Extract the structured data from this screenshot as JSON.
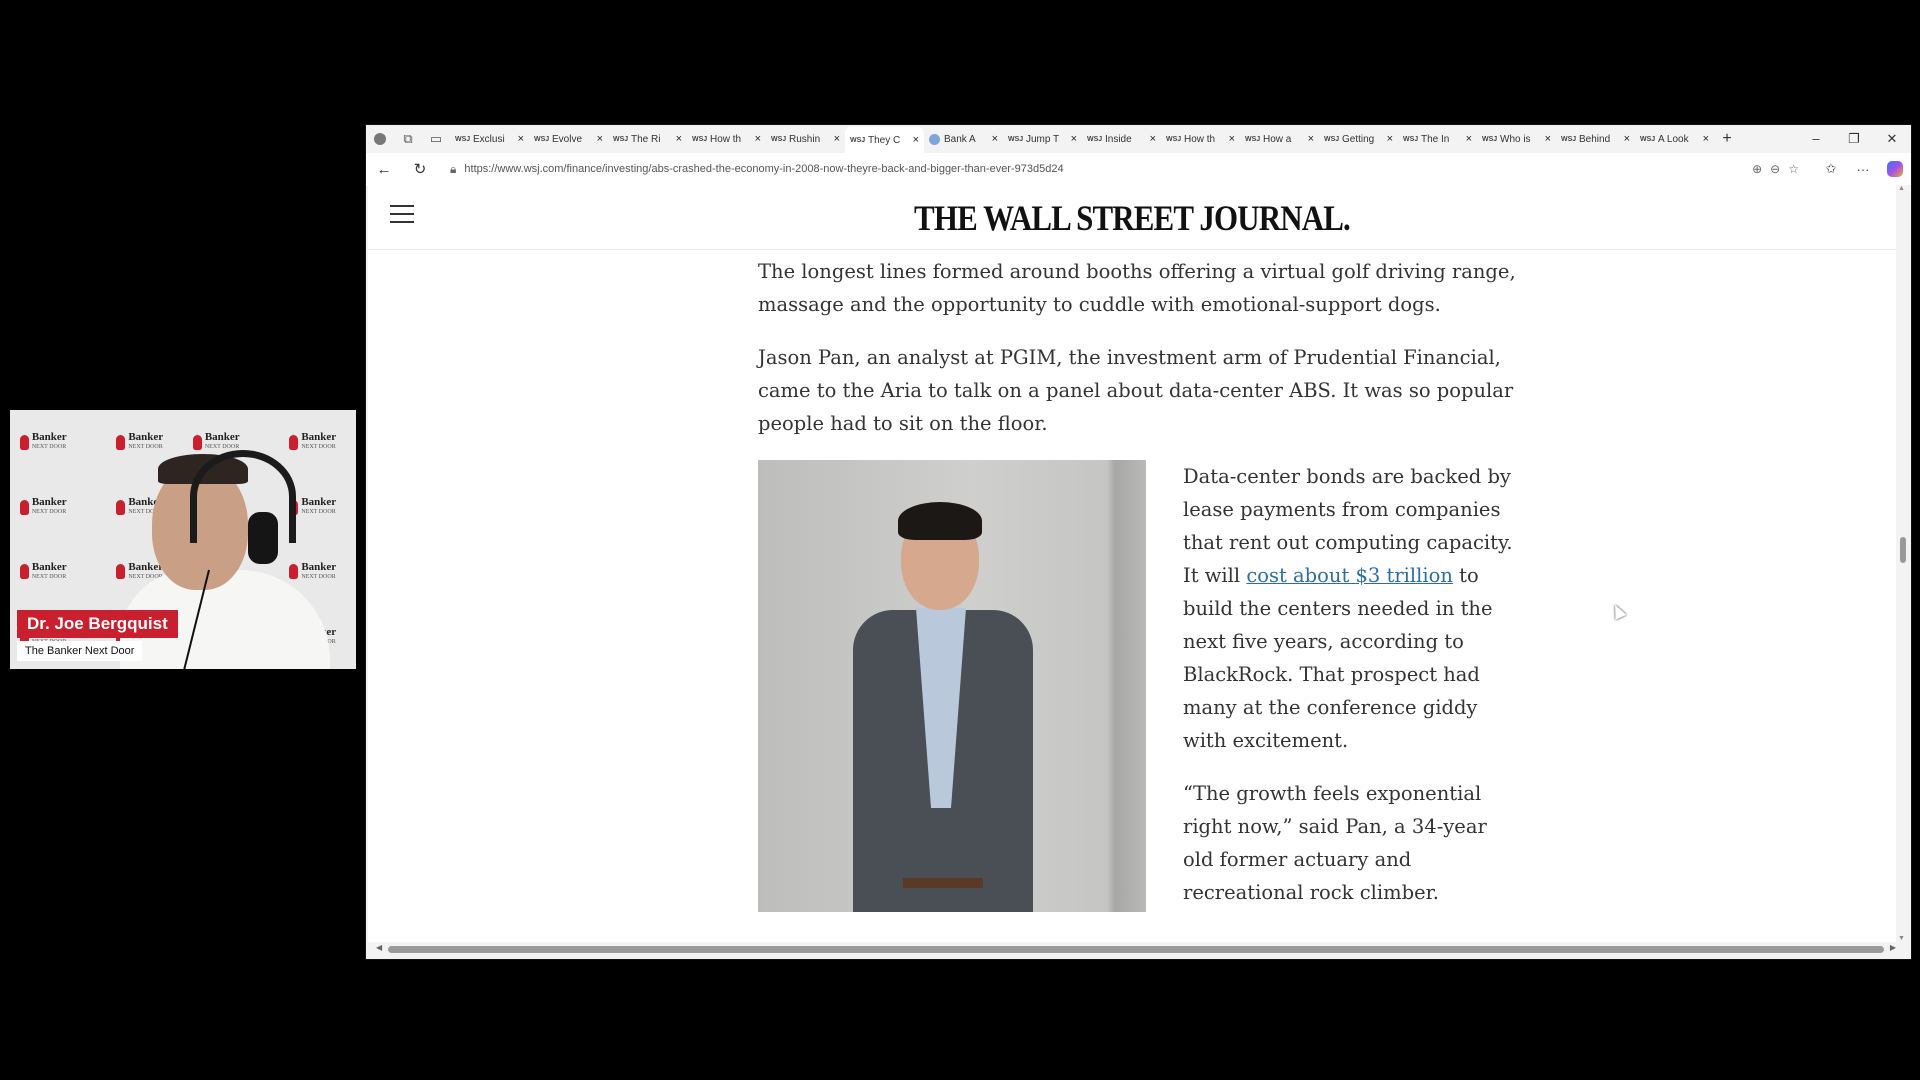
{
  "presenter": {
    "name": "Dr. Joe Bergquist",
    "show": "The Banker Next Door",
    "backdrop_logo": "Banker",
    "backdrop_logo_sub": "NEXT DOOR"
  },
  "browser": {
    "tabs": [
      {
        "label": "Exclusi",
        "favicon": "WSJ"
      },
      {
        "label": "Evolve",
        "favicon": "WSJ"
      },
      {
        "label": "The Ri",
        "favicon": "WSJ"
      },
      {
        "label": "How th",
        "favicon": "WSJ"
      },
      {
        "label": "Rushin",
        "favicon": "WSJ"
      },
      {
        "label": "They C",
        "favicon": "WSJ"
      },
      {
        "label": "Bank A",
        "favicon": "globe"
      },
      {
        "label": "Jump T",
        "favicon": "WSJ"
      },
      {
        "label": "Inside",
        "favicon": "WSJ"
      },
      {
        "label": "How th",
        "favicon": "WSJ"
      },
      {
        "label": "How a",
        "favicon": "WSJ"
      },
      {
        "label": "Getting",
        "favicon": "WSJ"
      },
      {
        "label": "The In",
        "favicon": "WSJ"
      },
      {
        "label": "Who is",
        "favicon": "WSJ"
      },
      {
        "label": "Behind",
        "favicon": "WSJ"
      },
      {
        "label": "A Look",
        "favicon": "WSJ"
      }
    ],
    "active_tab_index": 5,
    "url": "https://www.wsj.com/finance/investing/abs-crashed-the-economy-in-2008-now-theyre-back-and-bigger-than-ever-973d5d24"
  },
  "site": {
    "masthead": "THE WALL STREET JOURNAL."
  },
  "article": {
    "p1": "The longest lines formed around booths offering a virtual golf driving range, massage and the opportunity to cuddle with emotional-support dogs.",
    "p2": "Jason Pan, an analyst at PGIM, the investment arm of Prudential Financial, came to the Aria to talk on a panel about data-center ABS. It was so popular people had to sit on the floor.",
    "p3_before": "Data-center bonds are backed by lease payments from companies that rent out computing capacity. It will ",
    "p3_link": "cost about $3 trillion",
    "p3_after": " to build the centers needed in the next five years, according to BlackRock. That prospect had many at the conference giddy with excitement.",
    "p4": "“The growth feels exponential right now,” said Pan, a 34-year old former actuary and recreational rock climber."
  },
  "colors": {
    "name_tag": "#c8202e",
    "link": "#2b6ea3"
  }
}
